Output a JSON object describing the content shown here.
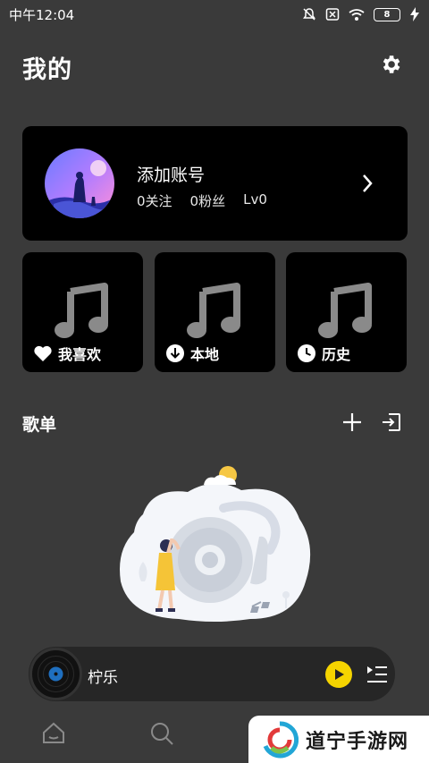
{
  "status_bar": {
    "time": "中午12:04",
    "battery": "8"
  },
  "page": {
    "title": "我的"
  },
  "account": {
    "name": "添加账号",
    "follow_count": "0关注",
    "fans_count": "0粉丝",
    "level": "Lv0"
  },
  "tiles": [
    {
      "label": "我喜欢",
      "icon": "heart-icon"
    },
    {
      "label": "本地",
      "icon": "download-icon"
    },
    {
      "label": "历史",
      "icon": "clock-icon"
    }
  ],
  "playlist_section": {
    "title": "歌单"
  },
  "player": {
    "track": "柠乐"
  },
  "watermark": {
    "text": "道宁手游网"
  },
  "colors": {
    "background": "#3a3a3a",
    "card": "#000000",
    "accent": "#f5d400"
  }
}
